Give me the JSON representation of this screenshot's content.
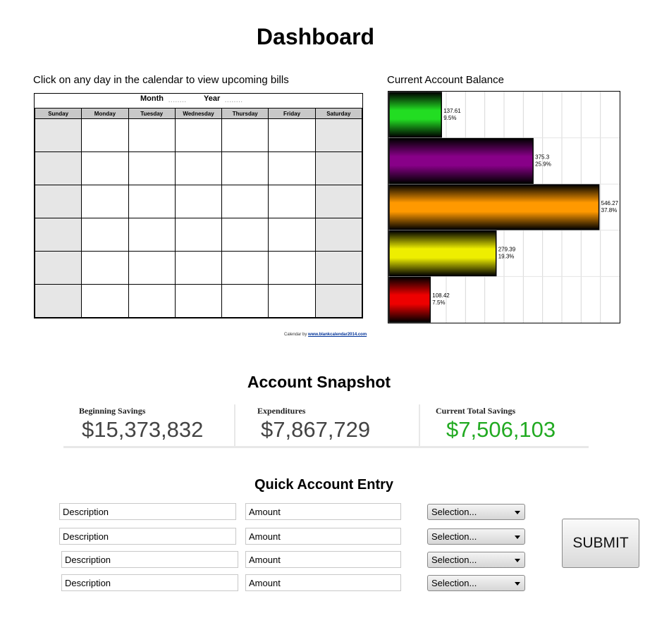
{
  "page": {
    "title": "Dashboard"
  },
  "calendar": {
    "caption": "Click on any day in the calendar to view upcoming bills",
    "month_label": "Month",
    "year_label": "Year",
    "days": [
      "Sunday",
      "Monday",
      "Tuesday",
      "Wednesday",
      "Thursday",
      "Friday",
      "Saturday"
    ],
    "weeks": 6,
    "credit_prefix": "Calendar by",
    "credit_link": "www.blankcalendar2014.com"
  },
  "balance_chart": {
    "caption": "Current Account Balance"
  },
  "chart_data": {
    "type": "bar",
    "orientation": "horizontal",
    "values": [
      137.61,
      375.3,
      546.27,
      279.39,
      108.42
    ],
    "percent_labels": [
      "9.5%",
      "25.9%",
      "37.8%",
      "19.3%",
      "7.5%"
    ],
    "value_labels": [
      "137.61",
      "375.3",
      "546.27",
      "279.39",
      "108.42"
    ],
    "colors": [
      "#22dd22",
      "#880088",
      "#ff9900",
      "#eeee00",
      "#ee0000"
    ],
    "xlim": [
      0,
      600
    ],
    "grid": true,
    "title": "",
    "xlabel": "",
    "ylabel": ""
  },
  "snapshot": {
    "title": "Account Snapshot",
    "beginning_label": "Beginning Savings",
    "beginning_value": "$15,373,832",
    "expenditures_label": "Expenditures",
    "expenditures_value": "$7,867,729",
    "current_label": "Current Total Savings",
    "current_value": "$7,506,103",
    "current_color": "#22aa22"
  },
  "quick_entry": {
    "title": "Quick Account Entry",
    "rows": [
      {
        "description": "Description",
        "amount": "Amount",
        "selection": "Selection..."
      },
      {
        "description": "Description",
        "amount": "Amount",
        "selection": "Selection..."
      },
      {
        "description": "Description",
        "amount": "Amount",
        "selection": "Selection..."
      },
      {
        "description": "Description",
        "amount": "Amount",
        "selection": "Selection..."
      }
    ],
    "submit_label": "SUBMIT"
  }
}
